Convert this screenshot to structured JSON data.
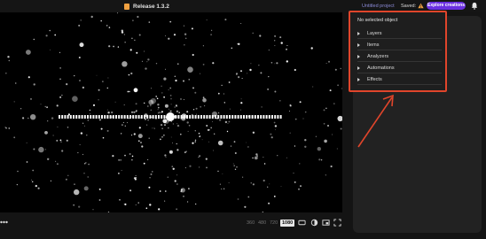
{
  "header": {
    "release": "Release 1.3.2",
    "project_name": "Untitled project",
    "saved_label": "Saved:",
    "explore_button": "Explore creations"
  },
  "properties": {
    "title": "No selected object",
    "sections": [
      {
        "label": "Layers"
      },
      {
        "label": "Items"
      },
      {
        "label": "Analyzers"
      },
      {
        "label": "Automations"
      },
      {
        "label": "Effects"
      }
    ]
  },
  "viewer": {
    "resolutions": [
      "360",
      "480",
      "720",
      "1080"
    ],
    "selected_resolution": "1080"
  },
  "colors": {
    "accent": "#6a2fe0",
    "annotation": "#e0452b",
    "project_link": "#8b8bd8",
    "warning": "#f0a040"
  },
  "icons": [
    "more-icon",
    "aspect-ratio-icon",
    "theme-toggle-icon",
    "picture-in-picture-icon",
    "fullscreen-icon",
    "warning-icon",
    "bell-icon"
  ]
}
